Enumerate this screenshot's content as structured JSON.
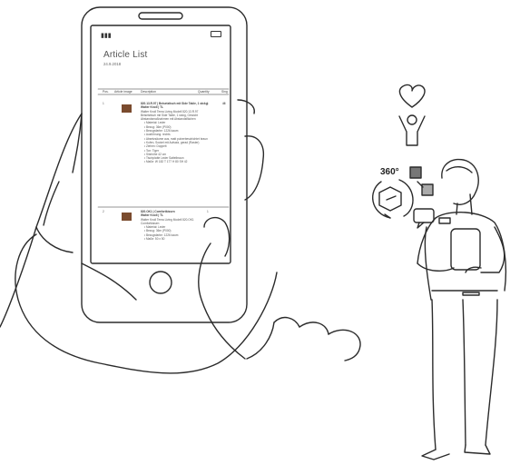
{
  "article_list": {
    "title": "Article List",
    "date": "24.9.2018",
    "columns": {
      "pos": "Pos.",
      "image": "Article image",
      "description": "Description",
      "quantity": "Quantity",
      "extra": "Sing"
    },
    "items": [
      {
        "pos": "1",
        "quantity": "1",
        "extra": "46",
        "heading": "820.13.R.97 | Beisetztisch mit Side Table, 1 stckg",
        "subheading": "Walter Knoll | TL",
        "body": "Walter Knoll Tema Living Modell 820.13.R.97 Beisetztisch mit Side Table, 1 stckg, Gewicht Abstandsmaßnahmen mit Abstandsflächen",
        "bullets": [
          "Material: Leder",
          "Bezug: 36m (P000)",
          "Bezugsfarbe: 1226 kaum",
          "Ausführung: rechts",
          "Absetzsäume aus, matt pulverbeschichtet braun",
          "Kufen, Sockel mit Aufsatz, gerad (Raster)",
          "Ziehen: Doppelt",
          "Ton: Tiger",
          "Sitzhöhe 42 cm",
          "Tischplatte Leder Sattelbraun",
          "Maße: W 182 T 177 H 80 SH 42"
        ]
      },
      {
        "pos": "2",
        "quantity": "1",
        "extra": "",
        "heading": "820.OK1 | Comfortkissen",
        "subheading": "Walter Knoll | TL",
        "body": "Walter Knoll Tema Living Modell 820.OK1 Comfortkissen",
        "bullets": [
          "Material: Leder",
          "Bezug: 36m (P000)",
          "Bezugsfarbe: 1226 kaum",
          "Maße: 50 x 50"
        ]
      }
    ]
  },
  "badge_360": "360°",
  "icons": [
    "signal-icon",
    "battery-icon",
    "heart-icon",
    "person-raising-arms-icon",
    "rotate-360-icon",
    "armchair-icon",
    "material-swatch-icon",
    "speech-bubble-icon",
    "tablet-icon"
  ]
}
